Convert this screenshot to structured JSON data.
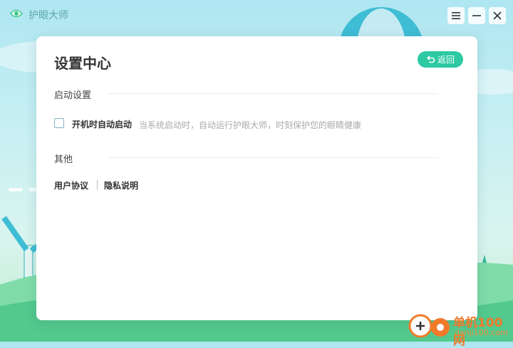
{
  "app": {
    "name": "护眼大师"
  },
  "window_controls": {
    "menu_icon": "menu-icon",
    "minimize_icon": "minimize-icon",
    "close_icon": "close-icon"
  },
  "settings": {
    "title": "设置中心",
    "back_label": "返回",
    "startup": {
      "section_title": "启动设置",
      "autostart_label": "开机时自动启动",
      "autostart_checked": false,
      "autostart_desc": "当系统启动时，自动运行护眼大师，时刻保护您的眼睛健康"
    },
    "other": {
      "section_title": "其他",
      "links": [
        "用户协议",
        "隐私说明"
      ]
    }
  },
  "watermark": {
    "text": "单机100网",
    "sub": "danji100.com"
  },
  "colors": {
    "accent": "#2cc9a3",
    "app_name": "#5fa8a6",
    "watermark": "#f07a2a"
  }
}
